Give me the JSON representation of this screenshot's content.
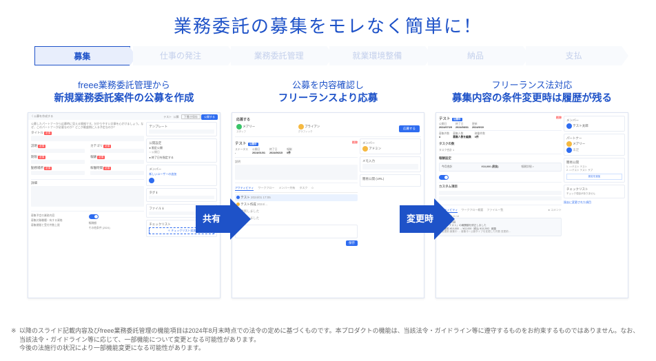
{
  "title": "業務委託の募集をモレなく簡単に！",
  "steps": [
    "募集",
    "仕事の発注",
    "業務委託管理",
    "就業環境整備",
    "納品",
    "支払"
  ],
  "columns": [
    {
      "sub": "freee業務委託管理から",
      "heading": "新規業務委託案件の公募を作成"
    },
    {
      "sub": "公募を内容確認し",
      "heading": "フリーランスより応募"
    },
    {
      "sub": "フリーランス法対応",
      "heading": "募集内容の条件変更時は履歴が残る"
    }
  ],
  "arrows": [
    "共有",
    "変更時"
  ],
  "shot1": {
    "header": "〈 公募を作成する",
    "nav": [
      "テスト",
      "公募"
    ],
    "btn_draft": "下書き保存",
    "btn_publish": "公開する",
    "helper": "公募したパートナーから応募時に見える情報です。分かりやすい文章を心がけましょう。なぜ、このパートナーが必要なのか？どこが最盛期に入る予定なのか？",
    "fields": {
      "title": "タイトル",
      "title_req": "必須",
      "desc": "説明",
      "desc_req": "必須",
      "cat": "カテゴリ",
      "period": "期限",
      "pay": "報酬",
      "area": "勤務場所",
      "hours": "稼働時間"
    },
    "sidebar": {
      "template": "テンプレート",
      "publish": "公開設定",
      "members": "メンバー",
      "newuser": "新しいユーザーの追加",
      "tag": "タグ",
      "file": "ファイル",
      "checklist": "チェックリスト",
      "checkbtn": "＋ チェックリスト追加"
    }
  },
  "shot2": {
    "apply_sec": "応募する",
    "name1": "メアリー",
    "name2": "ブライアン",
    "apply_btn": "応募する",
    "proj": "テスト",
    "status": "公開中",
    "delbtn": "削除",
    "tabs": [
      "アクティビティ",
      "ワークフロー",
      "メンバー共有",
      "タスク"
    ],
    "memo": "メモ入力",
    "activity": [
      "テスト",
      "テスト作成",
      "更新しました",
      "更新しました"
    ],
    "save": "保存"
  },
  "shot3": {
    "proj": "テスト",
    "status": "公開中",
    "delbtn": "削除",
    "members": "メンバー",
    "memo": "メモ入力",
    "partner": "パートナー",
    "task": "タスクの数",
    "checklist": "チェックリスト",
    "share": "簡易公開",
    "price": "¥10,000 (税抜)",
    "custom": "カスタム項目",
    "history": "過去に変更された項目",
    "tabs": [
      "アクティビティ",
      "ワークフロー概要",
      "ファイル一覧",
      "コメント"
    ]
  },
  "footnote": {
    "l1": "以降のスライド記載内容及びfreee業務委託管理の機能項目は2024年8月末時点での法令の定めに基づくものです。本プロダクトの機能は、当該法令・ガイドライン等に遵守するものをお約束するものではありません。なお、当該法令・ガイドライン等に応じて、一部機能について変更となる可能性があります。",
    "l2": "今後の法施行の状況により一部機能変更になる可能性があります。"
  }
}
